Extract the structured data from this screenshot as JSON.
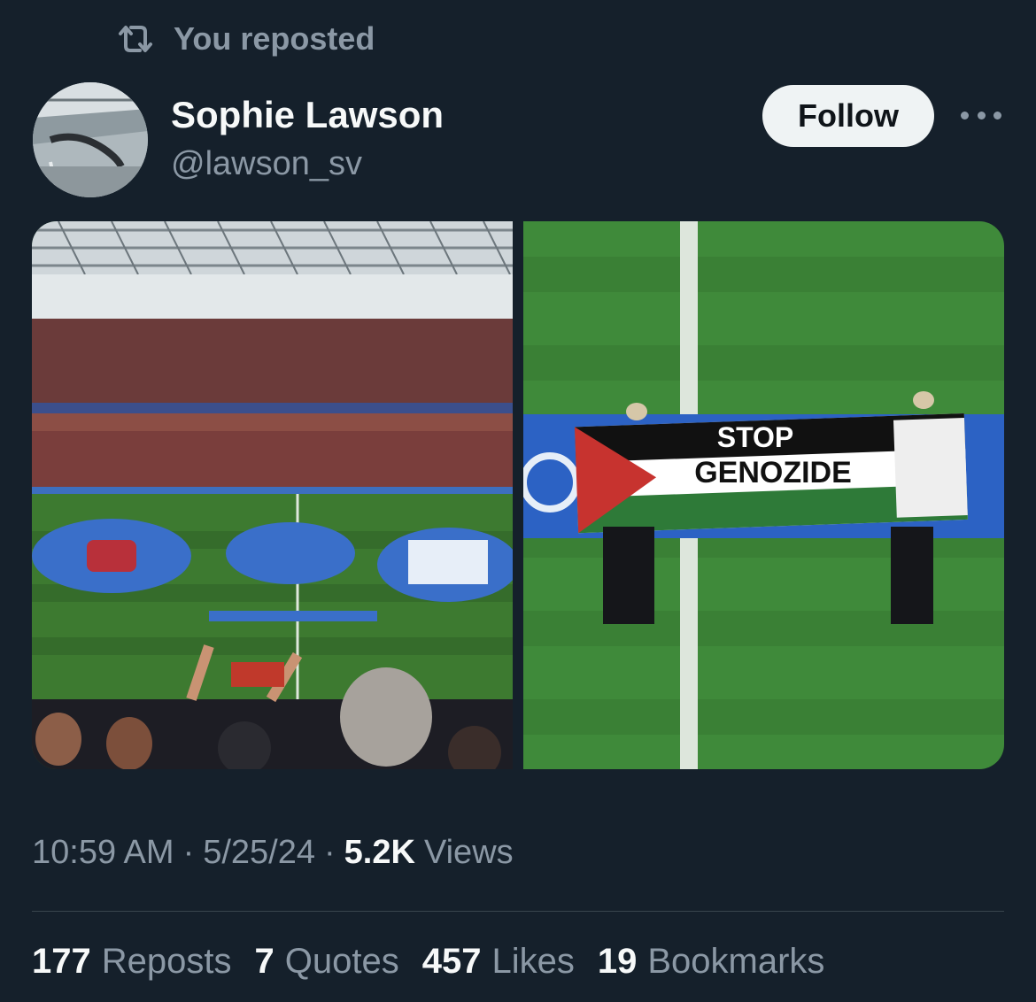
{
  "repost_banner": {
    "text": "You reposted",
    "icon": "repost-icon"
  },
  "author": {
    "name": "Sophie Lawson",
    "handle": "@lawson_sv",
    "avatar_icon": "avatar-photo"
  },
  "follow_button": {
    "label": "Follow"
  },
  "more_menu": {
    "icon": "more-horizontal-icon"
  },
  "media": {
    "left_photo": {
      "subject": "stadium-photo",
      "banner_text": ""
    },
    "right_photo": {
      "subject": "protest-banner-photo",
      "banner_line1": "STOP",
      "banner_line2": "GENOZIDE"
    }
  },
  "meta": {
    "time": "10:59 AM",
    "separator": "·",
    "date": "5/25/24",
    "views_count": "5.2K",
    "views_label": "Views"
  },
  "stats": [
    {
      "count": "177",
      "label": "Reposts"
    },
    {
      "count": "7",
      "label": "Quotes"
    },
    {
      "count": "457",
      "label": "Likes"
    },
    {
      "count": "19",
      "label": "Bookmarks"
    }
  ],
  "colors": {
    "background": "#15202b",
    "text_primary": "#f7f9f9",
    "text_secondary": "#8b98a5",
    "divider": "#38444d",
    "follow_bg": "#eff3f4"
  }
}
